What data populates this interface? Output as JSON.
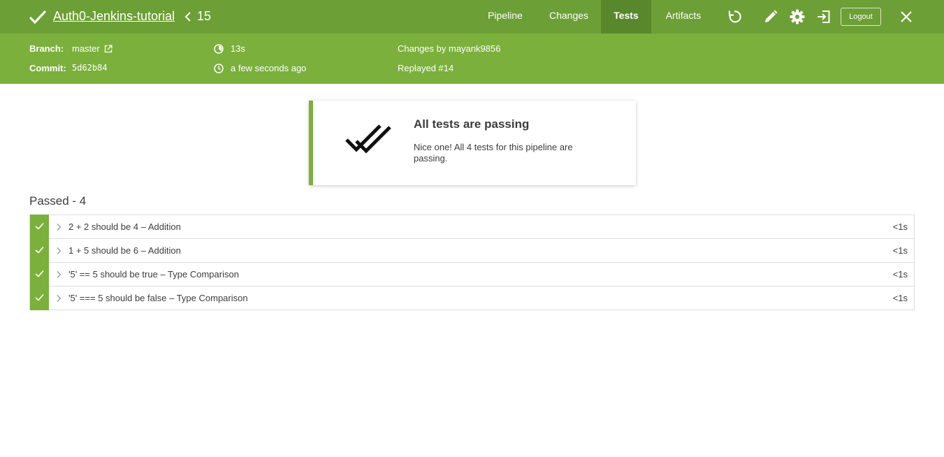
{
  "header": {
    "title": "Auth0-Jenkins-tutorial",
    "run_number": "15",
    "tabs": [
      {
        "label": "Pipeline",
        "active": false
      },
      {
        "label": "Changes",
        "active": false
      },
      {
        "label": "Tests",
        "active": true
      },
      {
        "label": "Artifacts",
        "active": false
      }
    ],
    "icons": [
      "replay-icon",
      "edit-icon",
      "settings-icon",
      "open-classic-icon",
      "close-icon"
    ],
    "logout_label": "Logout",
    "colors": {
      "bar": "#6c9f35",
      "active_tab": "#59872b"
    }
  },
  "summary": {
    "branch_label": "Branch:",
    "branch_value": "master",
    "commit_label": "Commit:",
    "commit_value": "5d62b84",
    "duration": "13s",
    "started": "a few seconds ago",
    "changes": "Changes by mayank9856",
    "replayed": "Replayed #14",
    "color": "#7bb03c"
  },
  "card": {
    "title": "All tests are passing",
    "message": "Nice one! All 4 tests for this pipeline are passing."
  },
  "results": {
    "heading": "Passed - 4",
    "tests": [
      {
        "name": "2 + 2 should be 4 – Addition",
        "duration": "<1s"
      },
      {
        "name": "1 + 5 should be 6 – Addition",
        "duration": "<1s"
      },
      {
        "name": "'5' == 5 should be true – Type Comparison",
        "duration": "<1s"
      },
      {
        "name": "'5' === 5 should be false – Type Comparison",
        "duration": "<1s"
      }
    ]
  }
}
